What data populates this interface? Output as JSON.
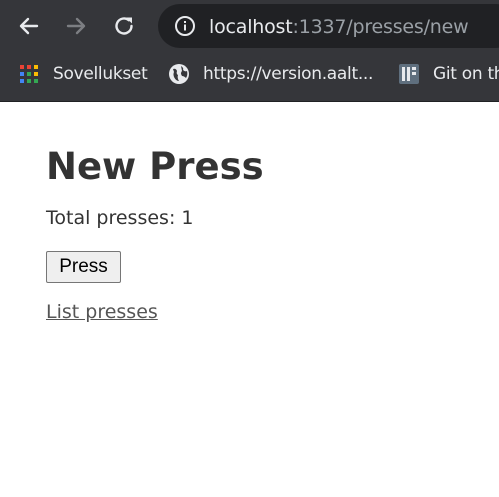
{
  "browser": {
    "url_host": "localhost",
    "url_rest": ":1337/presses/new",
    "bookmarks": [
      {
        "label": "Sovellukset",
        "icon": "apps-grid-icon"
      },
      {
        "label": "https://version.aalt...",
        "icon": "globe-icon"
      },
      {
        "label": "Git on th",
        "icon": "git-icon"
      }
    ]
  },
  "page": {
    "title": "New Press",
    "total_presses": "Total presses: 1",
    "press_button": "Press",
    "list_link": "List presses"
  }
}
